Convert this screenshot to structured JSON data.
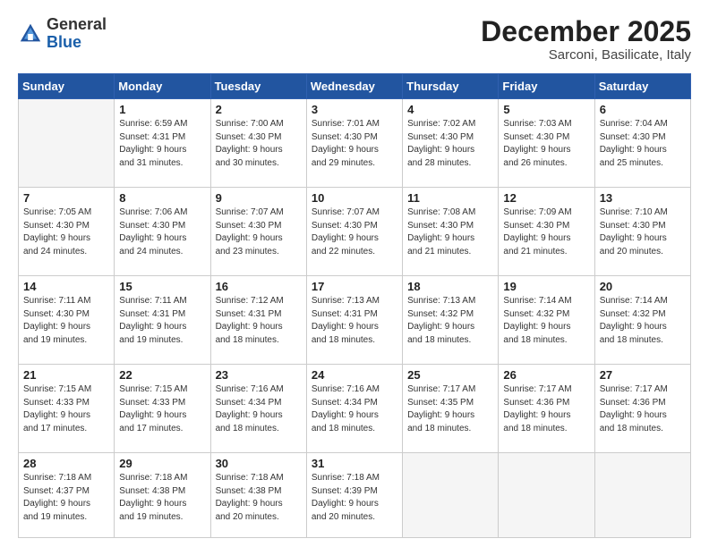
{
  "logo": {
    "general": "General",
    "blue": "Blue"
  },
  "title": "December 2025",
  "location": "Sarconi, Basilicate, Italy",
  "days_of_week": [
    "Sunday",
    "Monday",
    "Tuesday",
    "Wednesday",
    "Thursday",
    "Friday",
    "Saturday"
  ],
  "weeks": [
    [
      {
        "day": "",
        "info": ""
      },
      {
        "day": "1",
        "info": "Sunrise: 6:59 AM\nSunset: 4:31 PM\nDaylight: 9 hours\nand 31 minutes."
      },
      {
        "day": "2",
        "info": "Sunrise: 7:00 AM\nSunset: 4:30 PM\nDaylight: 9 hours\nand 30 minutes."
      },
      {
        "day": "3",
        "info": "Sunrise: 7:01 AM\nSunset: 4:30 PM\nDaylight: 9 hours\nand 29 minutes."
      },
      {
        "day": "4",
        "info": "Sunrise: 7:02 AM\nSunset: 4:30 PM\nDaylight: 9 hours\nand 28 minutes."
      },
      {
        "day": "5",
        "info": "Sunrise: 7:03 AM\nSunset: 4:30 PM\nDaylight: 9 hours\nand 26 minutes."
      },
      {
        "day": "6",
        "info": "Sunrise: 7:04 AM\nSunset: 4:30 PM\nDaylight: 9 hours\nand 25 minutes."
      }
    ],
    [
      {
        "day": "7",
        "info": "Sunrise: 7:05 AM\nSunset: 4:30 PM\nDaylight: 9 hours\nand 24 minutes."
      },
      {
        "day": "8",
        "info": "Sunrise: 7:06 AM\nSunset: 4:30 PM\nDaylight: 9 hours\nand 24 minutes."
      },
      {
        "day": "9",
        "info": "Sunrise: 7:07 AM\nSunset: 4:30 PM\nDaylight: 9 hours\nand 23 minutes."
      },
      {
        "day": "10",
        "info": "Sunrise: 7:07 AM\nSunset: 4:30 PM\nDaylight: 9 hours\nand 22 minutes."
      },
      {
        "day": "11",
        "info": "Sunrise: 7:08 AM\nSunset: 4:30 PM\nDaylight: 9 hours\nand 21 minutes."
      },
      {
        "day": "12",
        "info": "Sunrise: 7:09 AM\nSunset: 4:30 PM\nDaylight: 9 hours\nand 21 minutes."
      },
      {
        "day": "13",
        "info": "Sunrise: 7:10 AM\nSunset: 4:30 PM\nDaylight: 9 hours\nand 20 minutes."
      }
    ],
    [
      {
        "day": "14",
        "info": "Sunrise: 7:11 AM\nSunset: 4:30 PM\nDaylight: 9 hours\nand 19 minutes."
      },
      {
        "day": "15",
        "info": "Sunrise: 7:11 AM\nSunset: 4:31 PM\nDaylight: 9 hours\nand 19 minutes."
      },
      {
        "day": "16",
        "info": "Sunrise: 7:12 AM\nSunset: 4:31 PM\nDaylight: 9 hours\nand 18 minutes."
      },
      {
        "day": "17",
        "info": "Sunrise: 7:13 AM\nSunset: 4:31 PM\nDaylight: 9 hours\nand 18 minutes."
      },
      {
        "day": "18",
        "info": "Sunrise: 7:13 AM\nSunset: 4:32 PM\nDaylight: 9 hours\nand 18 minutes."
      },
      {
        "day": "19",
        "info": "Sunrise: 7:14 AM\nSunset: 4:32 PM\nDaylight: 9 hours\nand 18 minutes."
      },
      {
        "day": "20",
        "info": "Sunrise: 7:14 AM\nSunset: 4:32 PM\nDaylight: 9 hours\nand 18 minutes."
      }
    ],
    [
      {
        "day": "21",
        "info": "Sunrise: 7:15 AM\nSunset: 4:33 PM\nDaylight: 9 hours\nand 17 minutes."
      },
      {
        "day": "22",
        "info": "Sunrise: 7:15 AM\nSunset: 4:33 PM\nDaylight: 9 hours\nand 17 minutes."
      },
      {
        "day": "23",
        "info": "Sunrise: 7:16 AM\nSunset: 4:34 PM\nDaylight: 9 hours\nand 18 minutes."
      },
      {
        "day": "24",
        "info": "Sunrise: 7:16 AM\nSunset: 4:34 PM\nDaylight: 9 hours\nand 18 minutes."
      },
      {
        "day": "25",
        "info": "Sunrise: 7:17 AM\nSunset: 4:35 PM\nDaylight: 9 hours\nand 18 minutes."
      },
      {
        "day": "26",
        "info": "Sunrise: 7:17 AM\nSunset: 4:36 PM\nDaylight: 9 hours\nand 18 minutes."
      },
      {
        "day": "27",
        "info": "Sunrise: 7:17 AM\nSunset: 4:36 PM\nDaylight: 9 hours\nand 18 minutes."
      }
    ],
    [
      {
        "day": "28",
        "info": "Sunrise: 7:18 AM\nSunset: 4:37 PM\nDaylight: 9 hours\nand 19 minutes."
      },
      {
        "day": "29",
        "info": "Sunrise: 7:18 AM\nSunset: 4:38 PM\nDaylight: 9 hours\nand 19 minutes."
      },
      {
        "day": "30",
        "info": "Sunrise: 7:18 AM\nSunset: 4:38 PM\nDaylight: 9 hours\nand 20 minutes."
      },
      {
        "day": "31",
        "info": "Sunrise: 7:18 AM\nSunset: 4:39 PM\nDaylight: 9 hours\nand 20 minutes."
      },
      {
        "day": "",
        "info": ""
      },
      {
        "day": "",
        "info": ""
      },
      {
        "day": "",
        "info": ""
      }
    ]
  ]
}
